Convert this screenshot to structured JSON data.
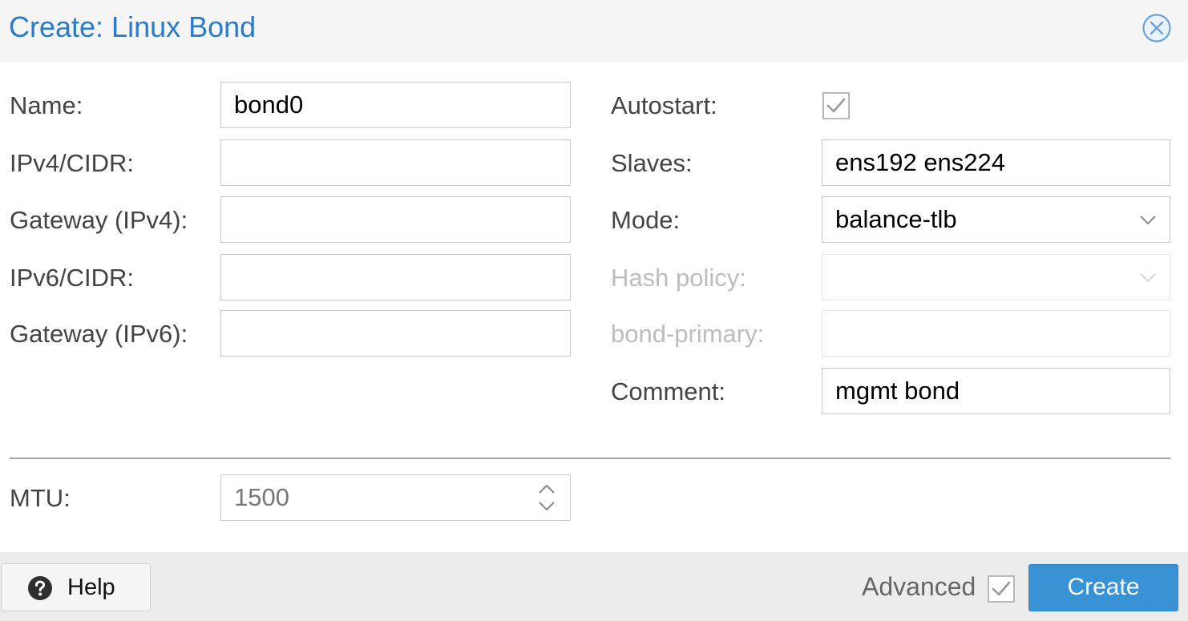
{
  "dialog": {
    "title": "Create: Linux Bond",
    "close_icon": "close-circle-icon",
    "accent_color": "#2a7bc8"
  },
  "left_column": {
    "name": {
      "label": "Name:",
      "value": "bond0"
    },
    "ipv4": {
      "label": "IPv4/CIDR:",
      "value": ""
    },
    "gateway_ipv4": {
      "label": "Gateway (IPv4):",
      "value": ""
    },
    "ipv6": {
      "label": "IPv6/CIDR:",
      "value": ""
    },
    "gateway_ipv6": {
      "label": "Gateway (IPv6):",
      "value": ""
    }
  },
  "right_column": {
    "autostart": {
      "label": "Autostart:",
      "checked": true
    },
    "slaves": {
      "label": "Slaves:",
      "value": "ens192 ens224"
    },
    "mode": {
      "label": "Mode:",
      "value": "balance-tlb"
    },
    "hash_policy": {
      "label": "Hash policy:",
      "value": "",
      "disabled": true
    },
    "bond_primary": {
      "label": "bond-primary:",
      "value": "",
      "disabled": true
    },
    "comment": {
      "label": "Comment:",
      "value": "mgmt bond"
    }
  },
  "advanced_section": {
    "mtu": {
      "label": "MTU:",
      "value": "1500"
    }
  },
  "footer": {
    "help_label": "Help",
    "help_icon": "question-circle-icon",
    "advanced_label": "Advanced",
    "advanced_checked": true,
    "create_label": "Create",
    "create_color": "#3892d4"
  }
}
